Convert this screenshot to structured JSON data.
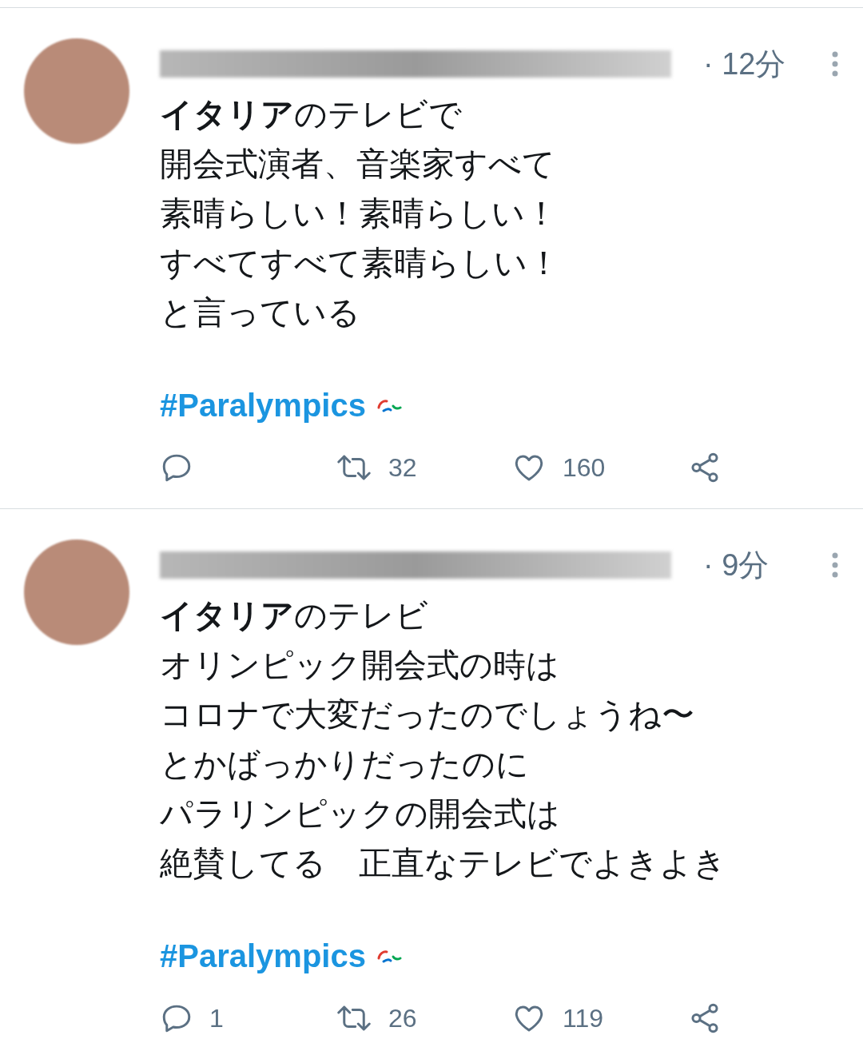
{
  "tweets": [
    {
      "time": "· 12分",
      "lines": [
        "**イタリア**のテレビで",
        "開会式演者、音楽家すべて",
        "素晴らしい！素晴らしい！",
        "すべてすべて素晴らしい！",
        "と言っている"
      ],
      "hashtag": "#Paralympics",
      "retweets": "32",
      "likes": "160"
    },
    {
      "time": "· 9分",
      "lines": [
        "**イタリア**のテレビ",
        "オリンピック開会式の時は",
        "コロナで大変だったのでしょうね〜",
        "とかばっかりだったのに",
        "パラリンピックの開会式は",
        "絶賛してる　正直なテレビでよきよき"
      ],
      "hashtag": "#Paralympics",
      "replies": "1",
      "retweets": "26",
      "likes": "119"
    }
  ]
}
